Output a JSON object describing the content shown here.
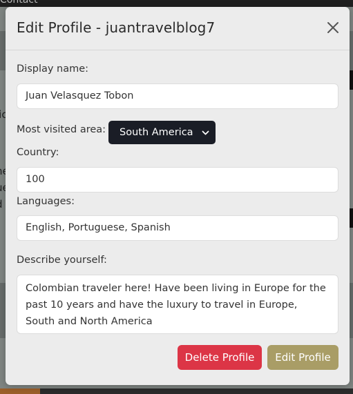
{
  "background": {
    "nav_link": "Contact",
    "edge_lines": [
      "lic",
      "ne",
      "ue",
      "d"
    ]
  },
  "modal": {
    "title": "Edit Profile - juantravelblog7",
    "close_icon": "close-icon",
    "display_name": {
      "label": "Display name:",
      "value": "Juan Velasquez Tobon"
    },
    "area": {
      "label": "Most visited area:",
      "selected": "South America",
      "icon": "chevron-down-icon"
    },
    "country": {
      "label": "Country:",
      "value": "100"
    },
    "languages": {
      "label": "Languages:",
      "value": "English, Portuguese, Spanish"
    },
    "describe": {
      "label": "Describe yourself:",
      "value": "Colombian traveler here! Have been living in Europe for the past 10 years and have the luxury to travel in Europe, South and North America"
    },
    "buttons": {
      "delete": "Delete Profile",
      "edit": "Edit Profile"
    }
  },
  "colors": {
    "danger": "#dc3546",
    "edit_button": "#a99d66",
    "select_bg": "#1a1d26"
  }
}
